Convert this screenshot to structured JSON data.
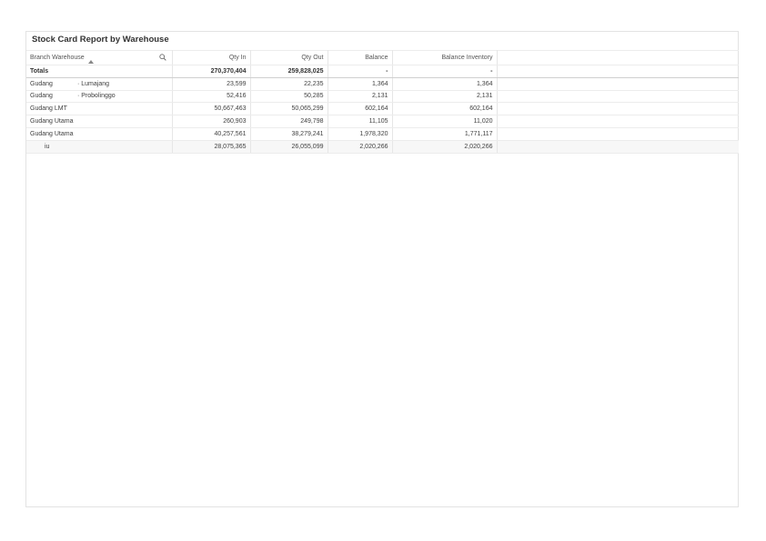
{
  "panel": {
    "title": "Stock Card Report by Warehouse"
  },
  "columns": {
    "name": "Branch Warehouse",
    "qty_in": "Qty In",
    "qty_out": "Qty Out",
    "balance": "Balance",
    "balance_inventory": "Balance Inventory"
  },
  "totals": {
    "label": "Totals",
    "qty_in": "270,370,404",
    "qty_out": "259,828,025",
    "balance": "-",
    "balance_inventory": "-"
  },
  "rows": [
    {
      "name": "Gudang",
      "sub": "· Lumajang",
      "qty_in": "23,599",
      "qty_out": "22,235",
      "balance": "1,364",
      "balance_inventory": "1,364"
    },
    {
      "name": "Gudang",
      "sub": "· Probolinggo",
      "qty_in": "52,416",
      "qty_out": "50,285",
      "balance": "2,131",
      "balance_inventory": "2,131"
    },
    {
      "name": "Gudang LMT",
      "sub": "",
      "qty_in": "50,667,463",
      "qty_out": "50,065,299",
      "balance": "602,164",
      "balance_inventory": "602,164"
    },
    {
      "name": "Gudang Utama",
      "sub": "",
      "qty_in": "260,903",
      "qty_out": "249,798",
      "balance": "11,105",
      "balance_inventory": "11,020"
    },
    {
      "name": "Gudang Utama",
      "sub": "",
      "qty_in": "40,257,561",
      "qty_out": "38,279,241",
      "balance": "1,978,320",
      "balance_inventory": "1,771,117"
    },
    {
      "name": "iu",
      "sub": "",
      "qty_in": "28,075,365",
      "qty_out": "26,055,099",
      "balance": "2,020,266",
      "balance_inventory": "2,020,266"
    }
  ]
}
